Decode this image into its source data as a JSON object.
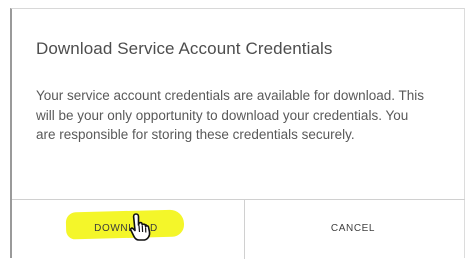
{
  "dialog": {
    "title": "Download Service Account Credentials",
    "message": "Your service account credentials are available for download. This will be your only opportunity to download your credentials. You are responsible for storing these credentials securely.",
    "buttons": {
      "download_label": "DOWNLOAD",
      "cancel_label": "CANCEL"
    }
  },
  "icons": {
    "cursor": "hand-pointer-icon"
  },
  "colors": {
    "highlight": "#f3f51f",
    "text": "#595959",
    "border": "#d0d0d0"
  }
}
